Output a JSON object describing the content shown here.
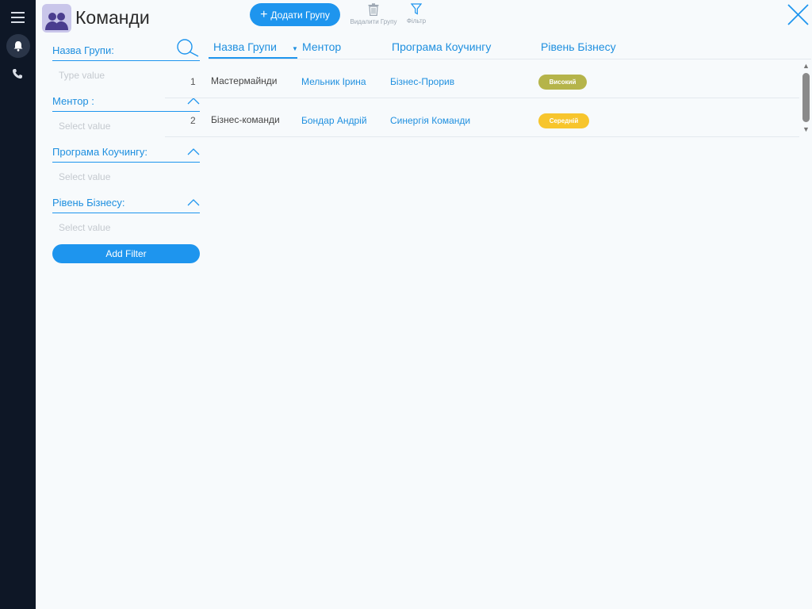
{
  "app": {
    "title": "Команди",
    "icon": "group-icon"
  },
  "toolbar": {
    "add_label": "Додати Групу",
    "delete_label": "Видалити Групу",
    "filter_label": "Фільтр"
  },
  "filters": [
    {
      "label": "Назва Групи:",
      "value": "Type value",
      "icon": "search-icon"
    },
    {
      "label": "Ментор :",
      "value": "Select value",
      "icon": "chevron-up-icon"
    },
    {
      "label": "Програма Коучингу:",
      "value": "Select value",
      "icon": "chevron-up-icon"
    },
    {
      "label": "Рівень Бізнесу:",
      "value": "Select value",
      "icon": "chevron-up-icon"
    }
  ],
  "add_filter_label": "Add Filter",
  "columns": [
    "Назва Групи",
    "Ментор",
    "Програма Коучингу",
    "Рівень Бізнесу"
  ],
  "sort_indicator": "▼",
  "rows": [
    {
      "num": "1",
      "name": "Мастермайнди",
      "mentor": "Мельник Ірина",
      "program": "Бізнес-Прорив",
      "level": "Високий",
      "level_color": "#b5b44a"
    },
    {
      "num": "2",
      "name": "Бізнес-команди",
      "mentor": "Бондар Андрій",
      "program": "Синергія Команди",
      "level": "Середній",
      "level_color": "#f7c52c"
    }
  ],
  "scrollbar": {
    "up": "▲",
    "down": "▼"
  },
  "colors": {
    "accent": "#1e95ee",
    "sidebar": "#0e1726"
  }
}
